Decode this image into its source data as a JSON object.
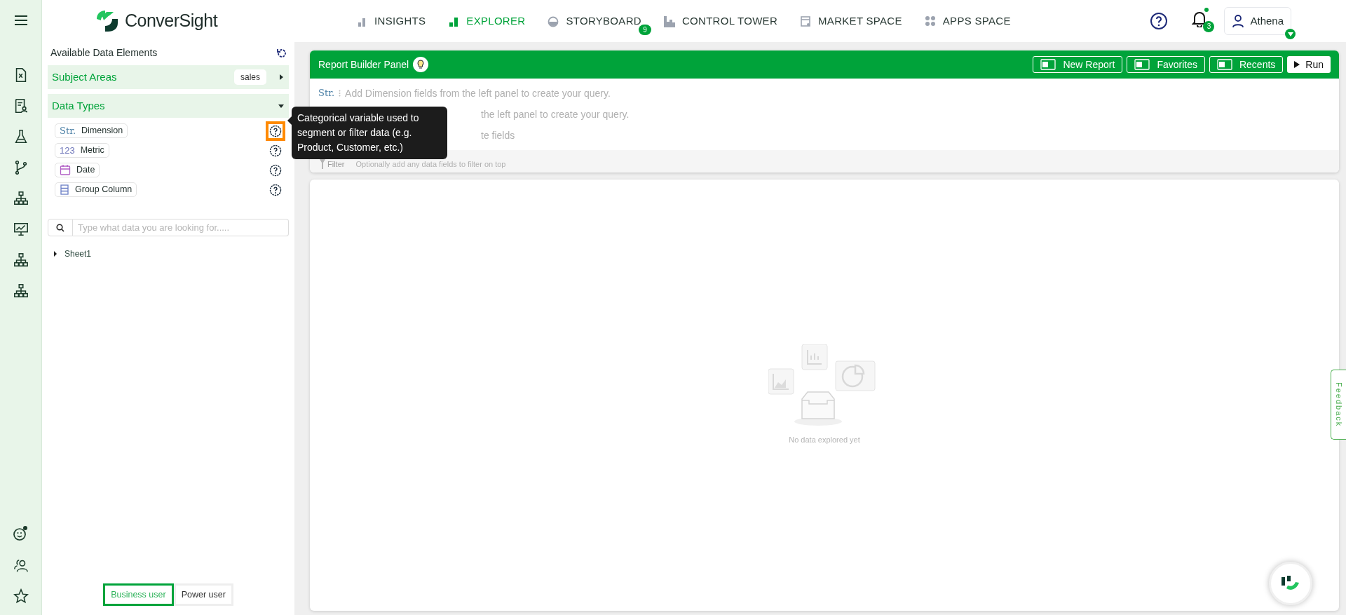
{
  "top_bar": {
    "logo": "ConverSight",
    "nav": [
      {
        "label": "INSIGHTS",
        "kind": "insights",
        "selected": false
      },
      {
        "label": "EXPLORER",
        "kind": "explorer",
        "selected": true
      },
      {
        "label": "STORYBOARD",
        "kind": "storyboard",
        "selected": false,
        "badge": "9"
      },
      {
        "label": "CONTROL TOWER",
        "kind": "tower",
        "selected": false
      },
      {
        "label": "MARKET SPACE",
        "kind": "market",
        "selected": false
      },
      {
        "label": "APPS SPACE",
        "kind": "apps",
        "selected": false
      }
    ],
    "notifications": {
      "count": "3",
      "unread": true
    },
    "user": {
      "name": "Athena"
    }
  },
  "data_panel": {
    "title": "Available Data Elements",
    "sections": [
      {
        "label": "Subject Areas",
        "value": "sales",
        "expanded": false
      },
      {
        "label": "Data Types",
        "expanded": true
      }
    ],
    "data_types": [
      {
        "kind": "dimension",
        "icon_text": "Str.",
        "label": "Dimension",
        "highlighted": true
      },
      {
        "kind": "metric",
        "icon_text": "123",
        "label": "Metric",
        "highlighted": false
      },
      {
        "kind": "date",
        "label": "Date",
        "highlighted": false
      },
      {
        "kind": "group",
        "label": "Group Column",
        "highlighted": false
      }
    ],
    "search": {
      "placeholder": "Type what data you are looking for....."
    },
    "tree": [
      {
        "label": "Sheet1",
        "expanded": false
      }
    ],
    "modes": [
      {
        "label": "Business user",
        "selected": true
      },
      {
        "label": "Power user",
        "selected": false
      }
    ]
  },
  "tooltip": {
    "text": "Categorical variable used to segment or filter data (e.g. Product, Customer, etc.)"
  },
  "report_builder": {
    "title": "Report Builder Panel",
    "buttons": [
      {
        "label": "New Report",
        "kind": "outline"
      },
      {
        "label": "Favorites",
        "kind": "outline"
      },
      {
        "label": "Recents",
        "kind": "outline"
      },
      {
        "label": "Run",
        "kind": "primary"
      }
    ],
    "rows": [
      {
        "kind": "dimension",
        "icon_text": "Str.",
        "text": "Add Dimension fields from the left panel to create your query."
      },
      {
        "kind": "covered",
        "text": "the left panel to create your query."
      },
      {
        "kind": "covered",
        "text": "te fields"
      }
    ],
    "filter": {
      "label": "Filter",
      "hint": "Optionally add any data fields to filter on top"
    }
  },
  "results": {
    "empty_message": "No data explored yet"
  },
  "feedback": {
    "label": "Feedback"
  }
}
